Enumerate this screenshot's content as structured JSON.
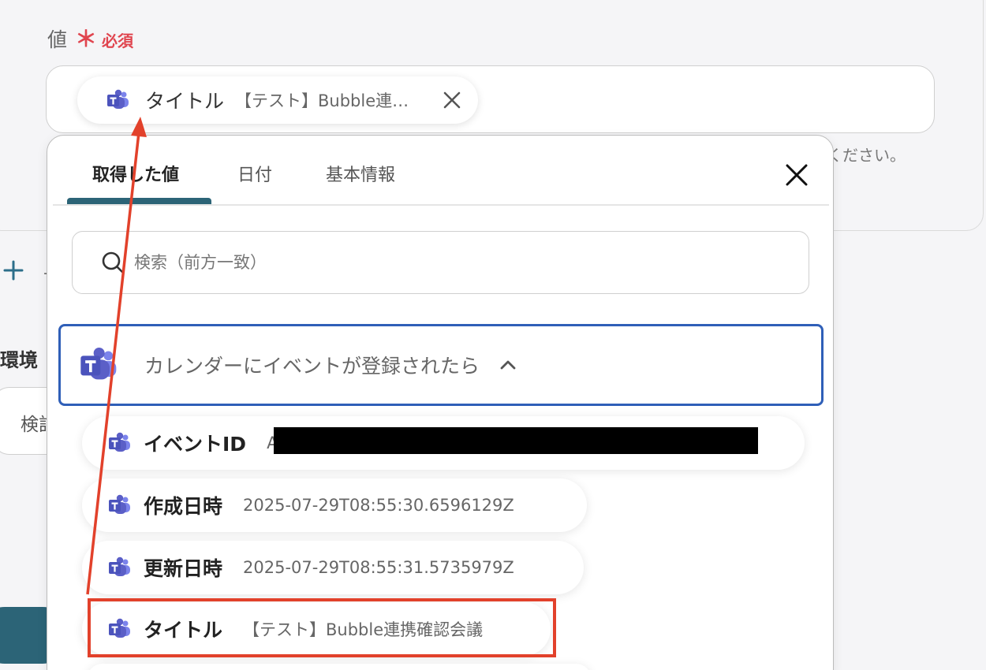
{
  "field": {
    "label": "値",
    "required_star": "＊",
    "required_text": "必須"
  },
  "chip": {
    "label": "タイトル",
    "value": "【テスト】Bubble連…"
  },
  "hint": "ください。",
  "plus_trail": "-",
  "env": {
    "label": "環境",
    "input_text": "検討"
  },
  "panel": {
    "tabs": [
      {
        "label": "取得した値",
        "active": true
      },
      {
        "label": "日付",
        "active": false
      },
      {
        "label": "基本情報",
        "active": false
      }
    ],
    "search": {
      "placeholder": "検索（前方一致）"
    },
    "group": {
      "title": "カレンダーにイベントが登録されたら"
    },
    "items": [
      {
        "label": "イベントID",
        "value": "A"
      },
      {
        "label": "作成日時",
        "value": "2025-07-29T08:55:30.6596129Z"
      },
      {
        "label": "更新日時",
        "value": "2025-07-29T08:55:31.5735979Z"
      },
      {
        "label": "タイトル",
        "value": "【テスト】Bubble連携確認会議"
      }
    ]
  },
  "colors": {
    "accent": "#2c6477",
    "required": "#e0454f",
    "group_border": "#2f5fb8",
    "annotation": "#e2412b",
    "teams_purple": "#5b5fc7"
  },
  "icons": {
    "app": "teams-icon",
    "search": "search-icon",
    "close": "close-icon",
    "collapse": "chevron-up-icon",
    "add": "plus-icon"
  }
}
